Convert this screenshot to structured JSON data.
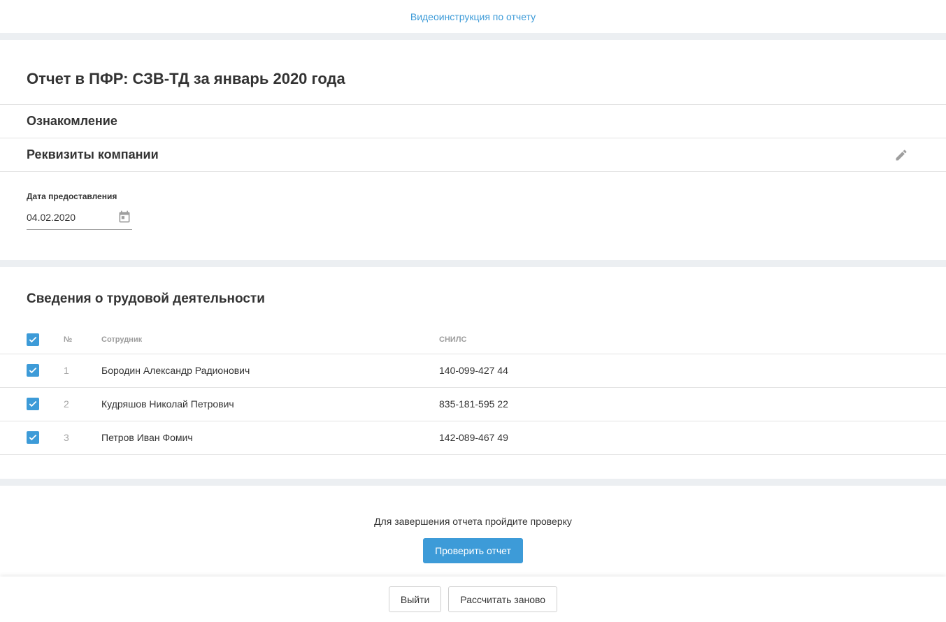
{
  "top": {
    "video_link": "Видеоинструкция по отчету"
  },
  "report": {
    "title": "Отчет в ПФР: СЗВ-ТД за январь 2020 года"
  },
  "sections": {
    "intro": "Ознакомление",
    "company": "Реквизиты компании"
  },
  "date": {
    "label": "Дата предоставления",
    "value": "04.02.2020"
  },
  "work": {
    "title": "Сведения о трудовой деятельности",
    "headers": {
      "num": "№",
      "employee": "Сотрудник",
      "snils": "СНИЛС"
    },
    "rows": [
      {
        "num": "1",
        "name": "Бородин Александр Радионович",
        "snils": "140-099-427 44",
        "checked": true
      },
      {
        "num": "2",
        "name": "Кудряшов Николай Петрович",
        "snils": "835-181-595 22",
        "checked": true
      },
      {
        "num": "3",
        "name": "Петров Иван Фомич",
        "snils": "142-089-467 49",
        "checked": true
      }
    ]
  },
  "verify": {
    "text": "Для завершения отчета пройдите проверку",
    "button": "Проверить отчет"
  },
  "footer": {
    "exit": "Выйти",
    "recalc": "Рассчитать заново"
  },
  "colors": {
    "accent": "#3d9bd8",
    "separator": "#eceff2"
  },
  "icons": {
    "edit": "pencil-icon",
    "calendar": "calendar-icon",
    "check": "checkmark-icon"
  }
}
